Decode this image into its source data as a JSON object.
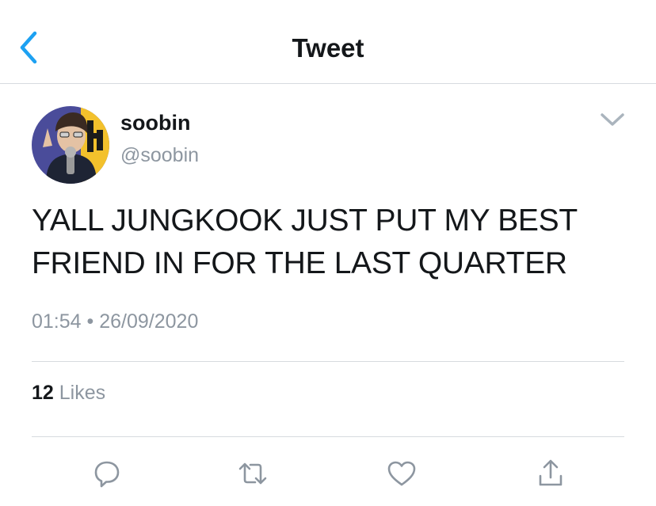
{
  "header": {
    "title": "Tweet",
    "back_icon": "chevron-left-icon"
  },
  "tweet": {
    "author": {
      "display_name": "soobin",
      "handle": "@soobin",
      "avatar": "avatar"
    },
    "text_line1": "YALL JUNGKOOK JUST PUT MY BEST",
    "text_line2": "FRIEND IN FOR THE LAST QUARTER",
    "time": "01:54",
    "separator": "•",
    "date": "26/09/2020",
    "likes": {
      "count": "12",
      "label": "Likes"
    }
  },
  "actions": [
    "reply-icon",
    "retweet-icon",
    "like-icon",
    "share-icon"
  ],
  "colors": {
    "accent": "#1da1f2",
    "text": "#14171a",
    "muted": "#8d96a0",
    "divider": "#d7dbdf"
  }
}
